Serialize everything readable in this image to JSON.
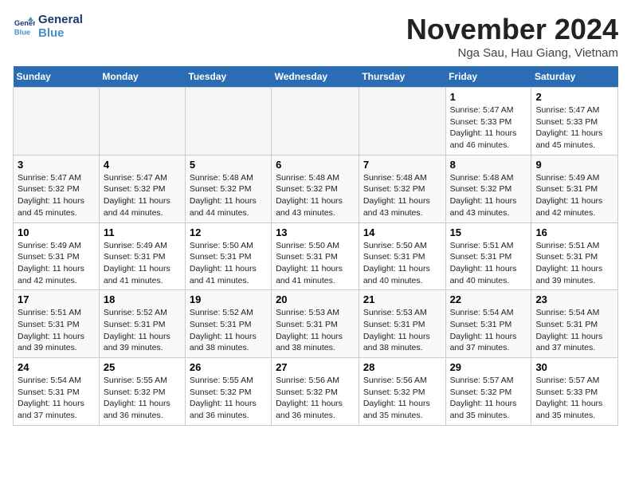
{
  "header": {
    "logo_line1": "General",
    "logo_line2": "Blue",
    "month": "November 2024",
    "location": "Nga Sau, Hau Giang, Vietnam"
  },
  "weekdays": [
    "Sunday",
    "Monday",
    "Tuesday",
    "Wednesday",
    "Thursday",
    "Friday",
    "Saturday"
  ],
  "weeks": [
    [
      {
        "day": "",
        "text": ""
      },
      {
        "day": "",
        "text": ""
      },
      {
        "day": "",
        "text": ""
      },
      {
        "day": "",
        "text": ""
      },
      {
        "day": "",
        "text": ""
      },
      {
        "day": "1",
        "text": "Sunrise: 5:47 AM\nSunset: 5:33 PM\nDaylight: 11 hours and 46 minutes."
      },
      {
        "day": "2",
        "text": "Sunrise: 5:47 AM\nSunset: 5:33 PM\nDaylight: 11 hours and 45 minutes."
      }
    ],
    [
      {
        "day": "3",
        "text": "Sunrise: 5:47 AM\nSunset: 5:32 PM\nDaylight: 11 hours and 45 minutes."
      },
      {
        "day": "4",
        "text": "Sunrise: 5:47 AM\nSunset: 5:32 PM\nDaylight: 11 hours and 44 minutes."
      },
      {
        "day": "5",
        "text": "Sunrise: 5:48 AM\nSunset: 5:32 PM\nDaylight: 11 hours and 44 minutes."
      },
      {
        "day": "6",
        "text": "Sunrise: 5:48 AM\nSunset: 5:32 PM\nDaylight: 11 hours and 43 minutes."
      },
      {
        "day": "7",
        "text": "Sunrise: 5:48 AM\nSunset: 5:32 PM\nDaylight: 11 hours and 43 minutes."
      },
      {
        "day": "8",
        "text": "Sunrise: 5:48 AM\nSunset: 5:32 PM\nDaylight: 11 hours and 43 minutes."
      },
      {
        "day": "9",
        "text": "Sunrise: 5:49 AM\nSunset: 5:31 PM\nDaylight: 11 hours and 42 minutes."
      }
    ],
    [
      {
        "day": "10",
        "text": "Sunrise: 5:49 AM\nSunset: 5:31 PM\nDaylight: 11 hours and 42 minutes."
      },
      {
        "day": "11",
        "text": "Sunrise: 5:49 AM\nSunset: 5:31 PM\nDaylight: 11 hours and 41 minutes."
      },
      {
        "day": "12",
        "text": "Sunrise: 5:50 AM\nSunset: 5:31 PM\nDaylight: 11 hours and 41 minutes."
      },
      {
        "day": "13",
        "text": "Sunrise: 5:50 AM\nSunset: 5:31 PM\nDaylight: 11 hours and 41 minutes."
      },
      {
        "day": "14",
        "text": "Sunrise: 5:50 AM\nSunset: 5:31 PM\nDaylight: 11 hours and 40 minutes."
      },
      {
        "day": "15",
        "text": "Sunrise: 5:51 AM\nSunset: 5:31 PM\nDaylight: 11 hours and 40 minutes."
      },
      {
        "day": "16",
        "text": "Sunrise: 5:51 AM\nSunset: 5:31 PM\nDaylight: 11 hours and 39 minutes."
      }
    ],
    [
      {
        "day": "17",
        "text": "Sunrise: 5:51 AM\nSunset: 5:31 PM\nDaylight: 11 hours and 39 minutes."
      },
      {
        "day": "18",
        "text": "Sunrise: 5:52 AM\nSunset: 5:31 PM\nDaylight: 11 hours and 39 minutes."
      },
      {
        "day": "19",
        "text": "Sunrise: 5:52 AM\nSunset: 5:31 PM\nDaylight: 11 hours and 38 minutes."
      },
      {
        "day": "20",
        "text": "Sunrise: 5:53 AM\nSunset: 5:31 PM\nDaylight: 11 hours and 38 minutes."
      },
      {
        "day": "21",
        "text": "Sunrise: 5:53 AM\nSunset: 5:31 PM\nDaylight: 11 hours and 38 minutes."
      },
      {
        "day": "22",
        "text": "Sunrise: 5:54 AM\nSunset: 5:31 PM\nDaylight: 11 hours and 37 minutes."
      },
      {
        "day": "23",
        "text": "Sunrise: 5:54 AM\nSunset: 5:31 PM\nDaylight: 11 hours and 37 minutes."
      }
    ],
    [
      {
        "day": "24",
        "text": "Sunrise: 5:54 AM\nSunset: 5:31 PM\nDaylight: 11 hours and 37 minutes."
      },
      {
        "day": "25",
        "text": "Sunrise: 5:55 AM\nSunset: 5:32 PM\nDaylight: 11 hours and 36 minutes."
      },
      {
        "day": "26",
        "text": "Sunrise: 5:55 AM\nSunset: 5:32 PM\nDaylight: 11 hours and 36 minutes."
      },
      {
        "day": "27",
        "text": "Sunrise: 5:56 AM\nSunset: 5:32 PM\nDaylight: 11 hours and 36 minutes."
      },
      {
        "day": "28",
        "text": "Sunrise: 5:56 AM\nSunset: 5:32 PM\nDaylight: 11 hours and 35 minutes."
      },
      {
        "day": "29",
        "text": "Sunrise: 5:57 AM\nSunset: 5:32 PM\nDaylight: 11 hours and 35 minutes."
      },
      {
        "day": "30",
        "text": "Sunrise: 5:57 AM\nSunset: 5:33 PM\nDaylight: 11 hours and 35 minutes."
      }
    ]
  ]
}
